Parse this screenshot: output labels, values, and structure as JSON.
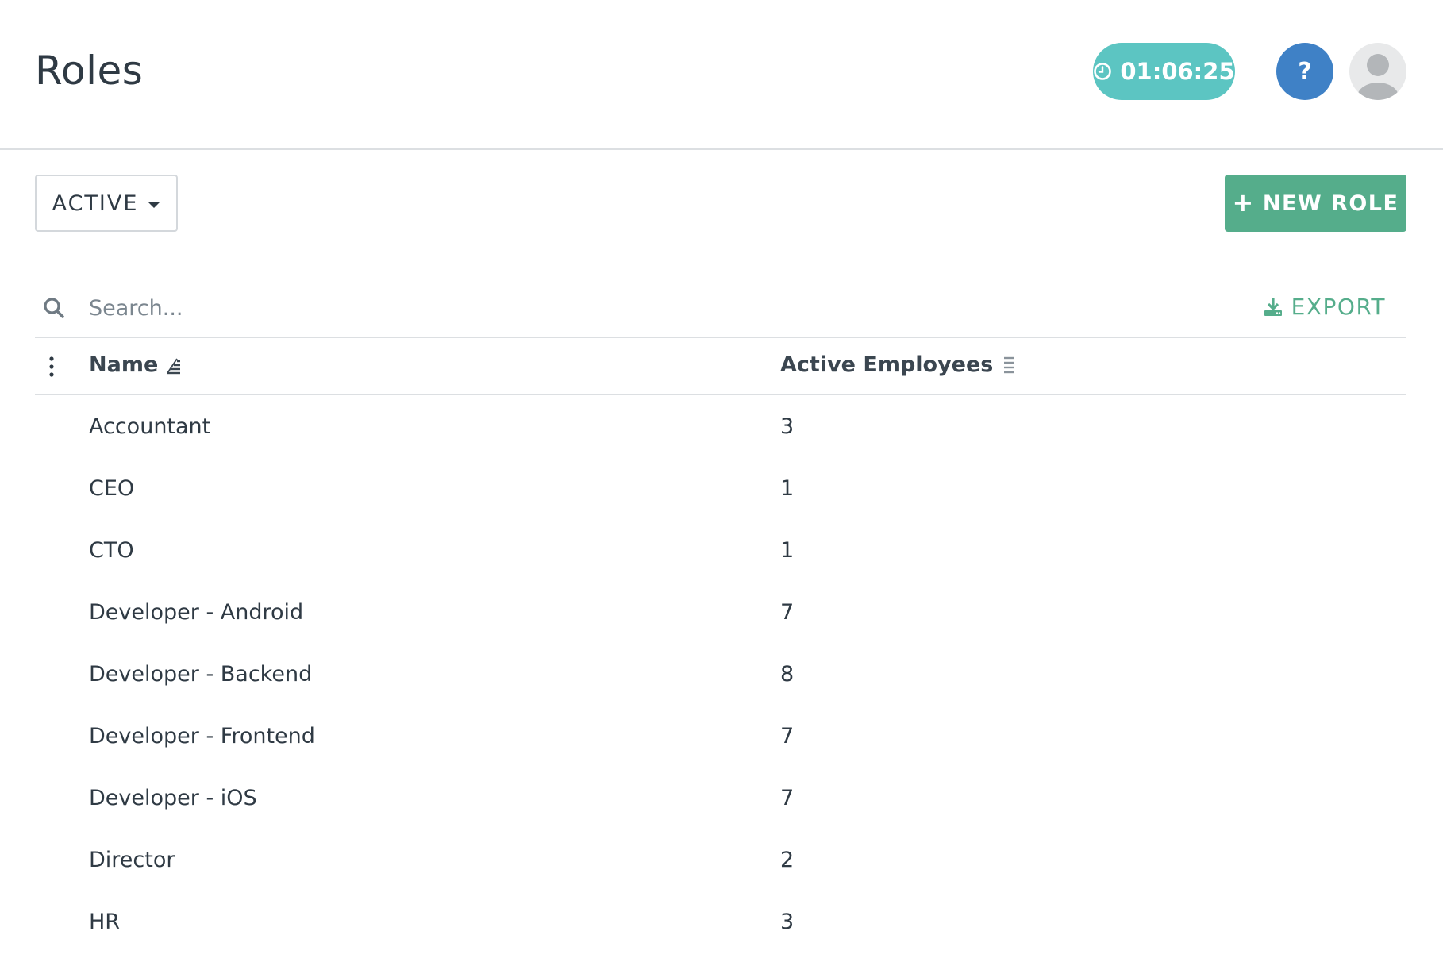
{
  "header": {
    "title": "Roles",
    "timer": "01:06:25",
    "help_label": "?"
  },
  "toolbar": {
    "filter_label": "ACTIVE",
    "new_role_label": "NEW ROLE"
  },
  "search": {
    "placeholder": "Search...",
    "export_label": "EXPORT"
  },
  "table": {
    "columns": [
      "Name",
      "Active Employees"
    ],
    "rows": [
      {
        "name": "Accountant",
        "count": "3"
      },
      {
        "name": "CEO",
        "count": "1"
      },
      {
        "name": "CTO",
        "count": "1"
      },
      {
        "name": "Developer - Android",
        "count": "7"
      },
      {
        "name": "Developer - Backend",
        "count": "8"
      },
      {
        "name": "Developer - Frontend",
        "count": "7"
      },
      {
        "name": "Developer - iOS",
        "count": "7"
      },
      {
        "name": "Director",
        "count": "2"
      },
      {
        "name": "HR",
        "count": "3"
      }
    ]
  },
  "colors": {
    "timer": "#5cc5c2",
    "help": "#3f81c6",
    "primary": "#55ad8b",
    "text": "#2f3a44"
  },
  "icons": {
    "timer": "clock-icon",
    "search": "search-icon",
    "export": "download-icon",
    "menu": "kebab-icon",
    "sort_active": "sort-ascending-icon",
    "sort_inactive": "sort-icon"
  }
}
